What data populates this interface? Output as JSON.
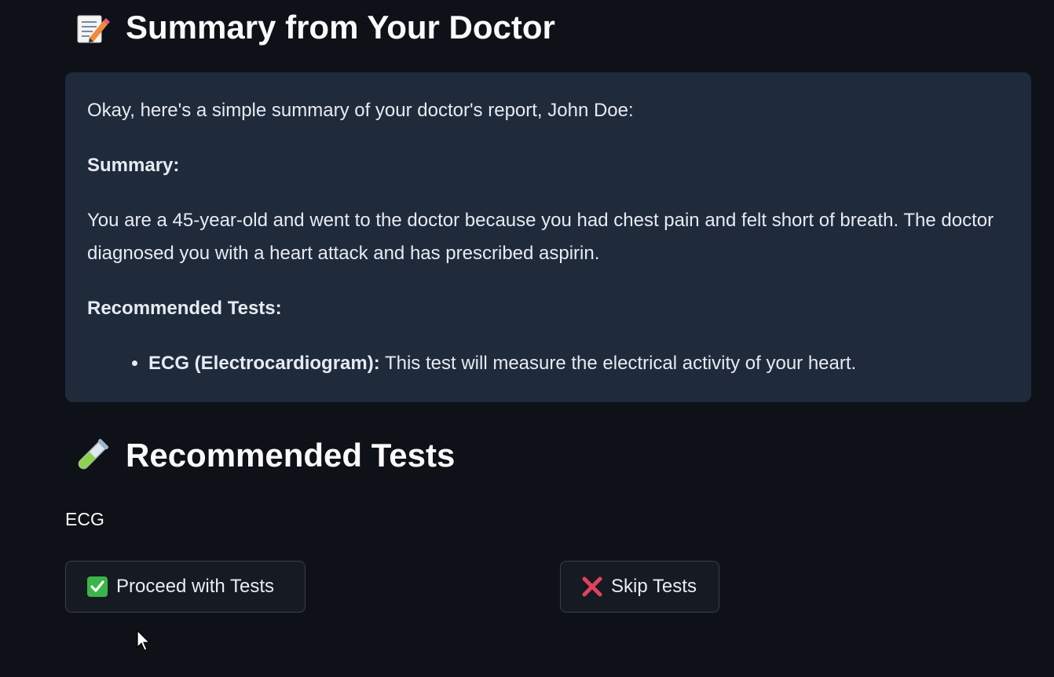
{
  "summary_section": {
    "icon": "memo-icon",
    "title": "Summary from Your Doctor",
    "intro": "Okay, here's a simple summary of your doctor's report, John Doe:",
    "summary_label": "Summary:",
    "summary_text": "You are a 45-year-old and went to the doctor because you had chest pain and felt short of breath. The doctor diagnosed you with a heart attack and has prescribed aspirin.",
    "tests_label": "Recommended Tests:",
    "tests": [
      {
        "name": "ECG (Electrocardiogram):",
        "description": " This test will measure the electrical activity of your heart."
      }
    ]
  },
  "tests_section": {
    "icon": "test-tube-icon",
    "title": "Recommended Tests",
    "test_list_text": "ECG"
  },
  "actions": {
    "proceed_label": "Proceed with Tests",
    "proceed_icon": "check-mark-button-icon",
    "skip_label": "Skip Tests",
    "skip_icon": "cross-mark-icon"
  },
  "colors": {
    "background": "#0e1117",
    "summary_box": "#1f2a3b",
    "check_green": "#3bb54a",
    "cross_red": "#e0435a"
  }
}
